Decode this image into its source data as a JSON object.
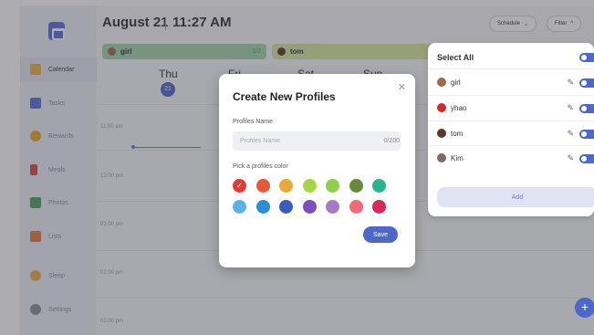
{
  "header": {
    "date": "August 21",
    "time": "11:27 AM",
    "schedule_label": "Schedule",
    "filter_label": "Filter"
  },
  "sidebar": {
    "items": [
      {
        "label": "Calendar",
        "icon": "calendar-icon",
        "color": "#e8b04a"
      },
      {
        "label": "Tasks",
        "icon": "tasks-icon",
        "color": "#5a6fd6"
      },
      {
        "label": "Rewards",
        "icon": "star-icon",
        "color": "#e8a62f"
      },
      {
        "label": "Meals",
        "icon": "utensils-icon",
        "color": "#d04a3a"
      },
      {
        "label": "Photos",
        "icon": "photo-icon",
        "color": "#4aa35a"
      },
      {
        "label": "Lists",
        "icon": "list-icon",
        "color": "#e07a4a"
      },
      {
        "label": "Sleep",
        "icon": "moon-icon",
        "color": "#e8b04a"
      },
      {
        "label": "Settings",
        "icon": "gear-icon",
        "color": "#8a8f9a"
      }
    ]
  },
  "calendar": {
    "profiles": [
      {
        "name": "girl",
        "count": "2/2",
        "color": "#9fd6a8"
      },
      {
        "name": "tom",
        "color": "#d7e6a0"
      }
    ],
    "days": [
      {
        "name": "Thu",
        "num": "21"
      },
      {
        "name": "Fri"
      },
      {
        "name": "Sat"
      },
      {
        "name": "Sun"
      }
    ],
    "hours": [
      "11:00 am",
      "12:00 pm",
      "01:00 pm",
      "02:00 pm",
      "03:00 pm"
    ]
  },
  "panel": {
    "select_all_label": "Select All",
    "profiles": [
      {
        "name": "girl",
        "color": "#a06a4a"
      },
      {
        "name": "yhao",
        "color": "#d02a2a"
      },
      {
        "name": "tom",
        "color": "#5a3a2a"
      },
      {
        "name": "Kim",
        "color": "#7a6a6a"
      }
    ],
    "add_label": "Add"
  },
  "modal": {
    "title": "Create New Profiles",
    "name_label": "Profiles Name",
    "name_placeholder": "Profiles Name",
    "name_value": "",
    "counter": "0/200",
    "color_label": "Pick a profiles color",
    "colors": [
      "#e53935",
      "#e8573a",
      "#e8a93a",
      "#a5d645",
      "#8fcf4a",
      "#6a8a3a",
      "#2ab38f",
      "#5ab4e8",
      "#2a8fd6",
      "#3a5bbf",
      "#7a4fbf",
      "#a57ac7",
      "#f06a7a",
      "#d62a5a"
    ],
    "selected_color_index": 0,
    "save_label": "Save"
  }
}
